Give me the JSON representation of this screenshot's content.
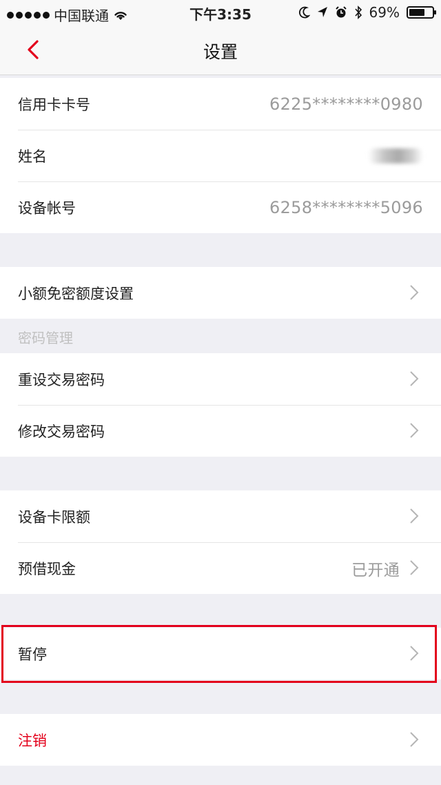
{
  "status_bar": {
    "carrier": "中国联通",
    "time": "下午3:35",
    "battery_text": "69%",
    "battery_level": 0.69
  },
  "nav": {
    "title": "设置",
    "back_icon": "chevron-left-icon",
    "accent_color": "#e3001b"
  },
  "account": {
    "card_number_label": "信用卡卡号",
    "card_number_value": "6225********0980",
    "name_label": "姓名",
    "device_account_label": "设备帐号",
    "device_account_value": "6258********5096"
  },
  "small_amount": {
    "label": "小额免密额度设置"
  },
  "password_section": {
    "header": "密码管理",
    "reset_label": "重设交易密码",
    "change_label": "修改交易密码"
  },
  "limits": {
    "device_card_limit_label": "设备卡限额",
    "prepay_cash_label": "预借现金",
    "prepay_cash_status": "已开通"
  },
  "suspend": {
    "label": "暂停"
  },
  "cancel": {
    "label": "注销"
  }
}
